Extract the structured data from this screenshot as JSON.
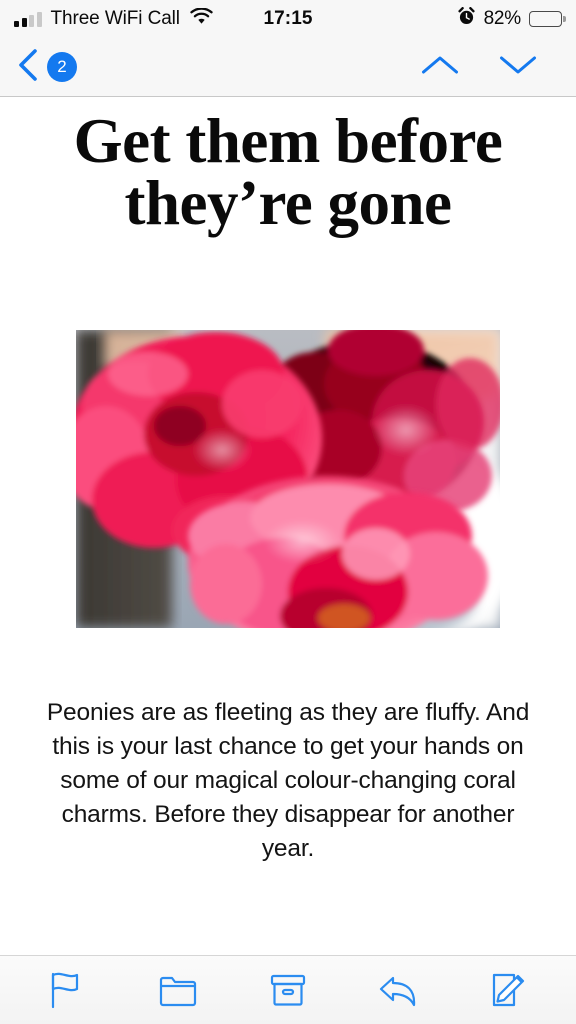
{
  "status_bar": {
    "carrier": "Three WiFi Call",
    "time": "17:15",
    "battery_percent": "82%",
    "battery_level": 82,
    "signal_bars_filled": 2,
    "signal_bars_total": 4,
    "wifi_icon": "wifi-icon",
    "alarm_icon": "alarm-clock-icon",
    "battery_icon": "battery-icon"
  },
  "nav_bar": {
    "back_icon": "chevron-left-icon",
    "unread_badge": "2",
    "prev_message_icon": "chevron-up-icon",
    "next_message_icon": "chevron-down-icon"
  },
  "email": {
    "headline": "Get them before they’re gone",
    "hero_image_alt": "peonies-photo",
    "body": "Peonies are as fleeting as they are fluffy. And this is your last chance to get your hands on some of our magical colour-changing coral charms. Before they disappear for another year."
  },
  "toolbar": {
    "items": [
      {
        "name": "flag-icon",
        "label": "Flag"
      },
      {
        "name": "folder-icon",
        "label": "Move to folder"
      },
      {
        "name": "archive-icon",
        "label": "Archive"
      },
      {
        "name": "reply-icon",
        "label": "Reply"
      },
      {
        "name": "compose-icon",
        "label": "Compose"
      }
    ]
  },
  "colors": {
    "accent_blue": "#1479ef",
    "toolbar_blue": "#2b8cf0",
    "status_bg": "#f7f7f7",
    "text_black": "#0a0a0a"
  }
}
